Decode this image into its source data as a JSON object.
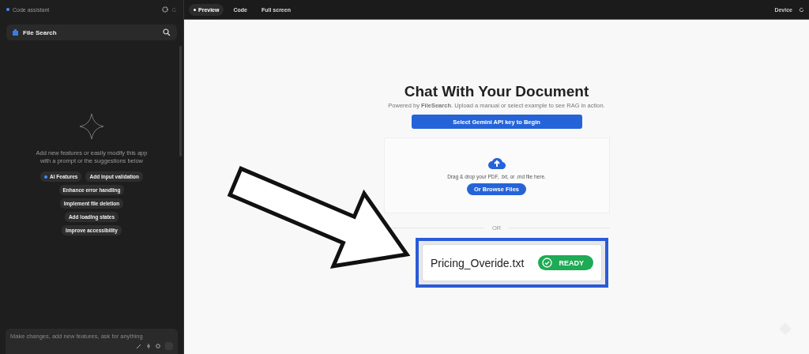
{
  "sidebar": {
    "title": "Code assistant",
    "search_label": "File Search",
    "hint": "Add new features or easily modify this app with a prompt or the suggestions below",
    "suggestions": [
      {
        "label": "AI Features",
        "kind": "dot"
      },
      {
        "label": "Add input validation",
        "kind": "plain"
      },
      {
        "label": "Enhance error handling",
        "kind": "plain"
      },
      {
        "label": "Implement file deletion",
        "kind": "plain"
      },
      {
        "label": "Add loading states",
        "kind": "plain"
      },
      {
        "label": "Improve accessibility",
        "kind": "plain"
      }
    ],
    "prompt": {
      "placeholder": "Make changes, add new features, ask for anything"
    }
  },
  "toolbar": {
    "tabs": [
      {
        "label": "Preview",
        "selected": true
      },
      {
        "label": "Code",
        "selected": false
      },
      {
        "label": "Full screen",
        "selected": false
      }
    ],
    "device": "Device"
  },
  "preview": {
    "title": "Chat With Your Document",
    "subtitle": "Powered by **FileSearch**. Upload a manual or select example to see RAG in action.",
    "key_button": "Select Gemini API key to Begin",
    "drop_text": "Drag & drop your PDF, .txt, or .md file here.",
    "browse_button": "Or Browse Files",
    "divider": "OR"
  },
  "callout": {
    "file_name": "Pricing_Overide.txt",
    "status": "READY"
  }
}
